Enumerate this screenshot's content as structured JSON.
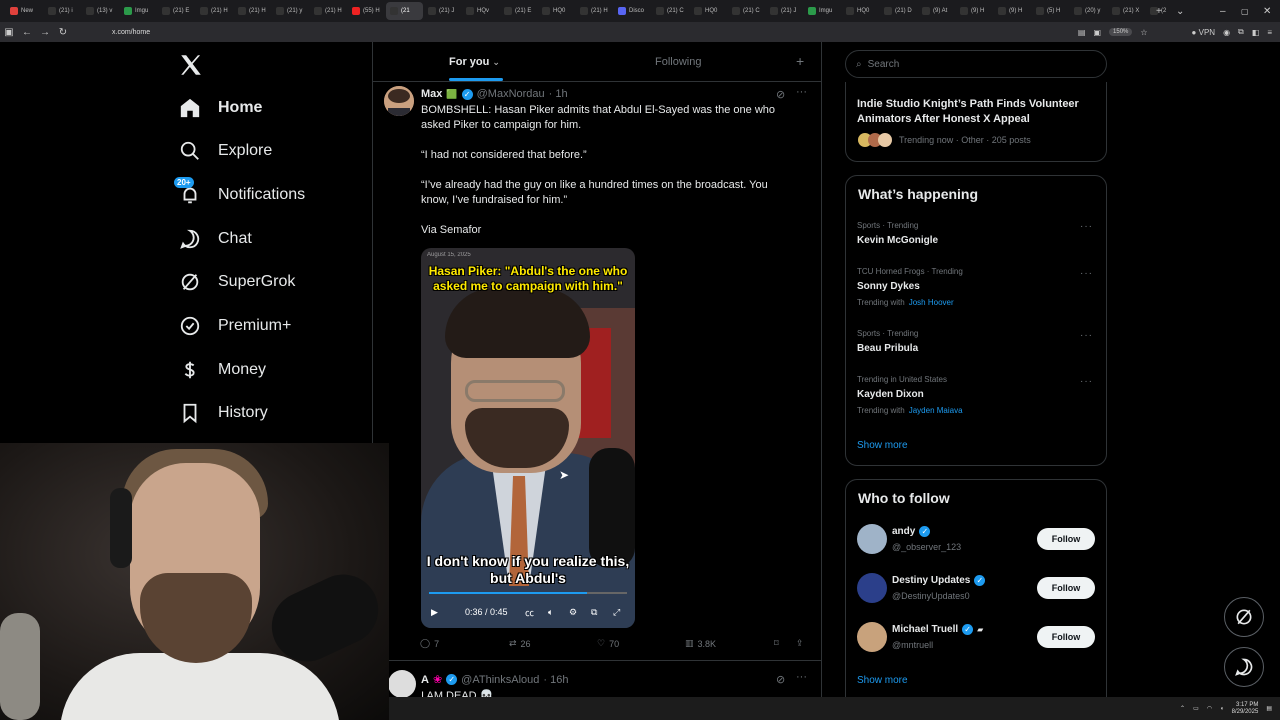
{
  "browser": {
    "tabs": [
      "New",
      "(21) i",
      "(13) v",
      "Imgu",
      "(21) E",
      "(21) H",
      "(21) H",
      "(21) y",
      "(21) H",
      "(55) H",
      "(21",
      "(21) J",
      "HQv",
      "(21) E",
      "HQ0",
      "(21) H",
      "Disco",
      "(21) C",
      "HQ0",
      "(21) C",
      "(21) J",
      "Imgu",
      "HQ0",
      "(21) D",
      "(9) At",
      "(9) H",
      "(9) H",
      "(5) H",
      "(20) y",
      "(21) X",
      "(2"
    ],
    "active_tab_index": 10,
    "url": "x.com/home",
    "zoom": "150%",
    "vpn": "VPN"
  },
  "sidebar": {
    "items": [
      {
        "label": "Home",
        "icon": "home-icon"
      },
      {
        "label": "Explore",
        "icon": "search-icon"
      },
      {
        "label": "Notifications",
        "icon": "bell-icon",
        "badge": "20+"
      },
      {
        "label": "Chat",
        "icon": "chat-icon"
      },
      {
        "label": "SuperGrok",
        "icon": "grok-icon"
      },
      {
        "label": "Premium+",
        "icon": "premium-icon"
      },
      {
        "label": "Money",
        "icon": "money-icon"
      },
      {
        "label": "History",
        "icon": "bookmark-icon"
      }
    ]
  },
  "feed": {
    "tabs": {
      "for_you": "For you",
      "following": "Following"
    },
    "post1": {
      "name": "Max",
      "flag": "🟩",
      "handle": "@MaxNordau",
      "time": "· 1h",
      "lines": [
        "BOMBSHELL: Hasan Piker admits that Abdul El-Sayed was the one who asked Piker to campaign for him.",
        "“I had not considered that before.”",
        "“I’ve already had the guy on like a hundred times on the broadcast. You know, I’ve fundraised for him.”",
        "Via Semafor"
      ],
      "video": {
        "date": "August 15, 2025",
        "caption_top": "Hasan Piker: \"Abdul's the one who asked me to campaign with him.\"",
        "caption_bottom": "I don't know if you realize this, but Abdul's",
        "time": "0:36 / 0:45",
        "progress": 0.8
      },
      "stats": {
        "replies": "7",
        "reposts": "26",
        "likes": "70",
        "views": "3.8K"
      }
    },
    "post2": {
      "name": "A",
      "emoji": "❀",
      "handle": "@AThinksAloud",
      "time": "· 16h",
      "text": "I AM DEAD 💀"
    }
  },
  "right": {
    "search_placeholder": "Search",
    "top_trend": {
      "title": "Indie Studio Knight’s Path Finds Volunteer Animators After Honest X Appeal",
      "meta": "Trending now · Other · 205 posts"
    },
    "whats_happening": {
      "title": "What’s happening",
      "trends": [
        {
          "category": "Sports · Trending",
          "name": "Kevin McGonigle",
          "with": ""
        },
        {
          "category": "TCU Horned Frogs · Trending",
          "name": "Sonny Dykes",
          "with": "Josh Hoover"
        },
        {
          "category": "Sports · Trending",
          "name": "Beau Pribula",
          "with": ""
        },
        {
          "category": "Trending in United States",
          "name": "Kayden Dixon",
          "with": "Jayden Maiava"
        }
      ],
      "trending_with_label": "Trending with",
      "show_more": "Show more"
    },
    "who_to_follow": {
      "title": "Who to follow",
      "accounts": [
        {
          "name": "andy",
          "handle": "@_observer_123"
        },
        {
          "name": "Destiny Updates",
          "handle": "@DestinyUpdates0"
        },
        {
          "name": "Michael Truell",
          "handle": "@mntruell"
        }
      ],
      "follow_label": "Follow",
      "show_more": "Show more"
    }
  },
  "taskbar": {
    "time": "3:17 PM",
    "date": "8/29/2025"
  },
  "colors": {
    "accent": "#1d9bf0",
    "background": "#000000",
    "border": "#2f3336",
    "muted": "#71767b"
  }
}
